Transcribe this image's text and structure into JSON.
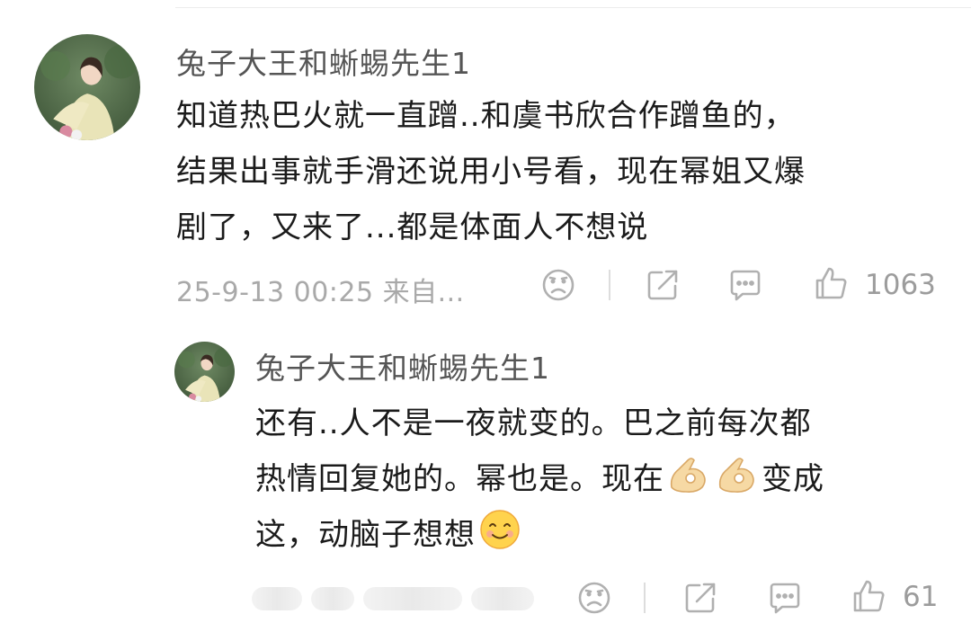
{
  "comment": {
    "username": "兔子大王和蜥蜴先生1",
    "content_lines": [
      "知道热巴火就一直蹭..和虞书欣合作蹭鱼的，",
      "结果出事就手滑还说用小号看，现在幂姐又爆",
      "剧了，又来了...都是体面人不想说"
    ],
    "meta": "25-9-13 00:25 来自...",
    "likes": "1063",
    "icons": [
      "sad-face-icon",
      "share-icon",
      "comment-icon",
      "thumbs-up-icon"
    ]
  },
  "reply": {
    "username": "兔子大王和蜥蜴先生1",
    "line1": "还有..人不是一夜就变的。巴之前每次都",
    "line2_a": "热情回复她的。幂也是。现在",
    "line2_b": "变成",
    "line3": "这，动脑子想想",
    "inline_emojis": [
      "ok-hand-emoji",
      "ok-hand-emoji",
      "smiling-face-emoji"
    ],
    "likes": "61",
    "icons": [
      "sad-face-icon",
      "share-icon",
      "comment-icon",
      "thumbs-up-icon"
    ]
  },
  "colors": {
    "text": "#1b1b1b",
    "username": "#555555",
    "meta": "#a9a9a9",
    "icon": "#b0b0b0"
  }
}
